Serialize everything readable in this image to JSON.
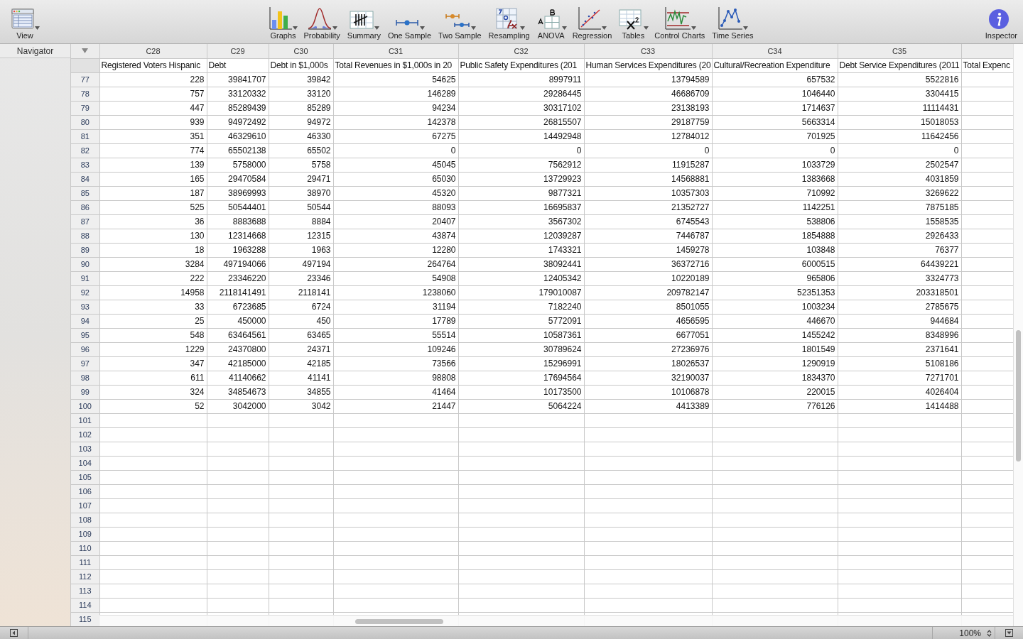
{
  "toolbar": {
    "left": [
      {
        "label": "View"
      }
    ],
    "tools": [
      {
        "label": "Graphs"
      },
      {
        "label": "Probability"
      },
      {
        "label": "Summary"
      },
      {
        "label": "One Sample"
      },
      {
        "label": "Two Sample"
      },
      {
        "label": "Resampling"
      },
      {
        "label": "ANOVA"
      },
      {
        "label": "Regression"
      },
      {
        "label": "Tables"
      },
      {
        "label": "Control Charts"
      },
      {
        "label": "Time Series"
      }
    ],
    "right": [
      {
        "label": "Inspector"
      }
    ]
  },
  "navigator": {
    "title": "Navigator"
  },
  "table": {
    "columns": [
      {
        "id": "C28",
        "name": "Registered Voters Hispanic"
      },
      {
        "id": "C29",
        "name": "Debt"
      },
      {
        "id": "C30",
        "name": "Debt in $1,000s"
      },
      {
        "id": "C31",
        "name": "Total Revenues in $1,000s in 20"
      },
      {
        "id": "C32",
        "name": "Public Safety Expenditures (201"
      },
      {
        "id": "C33",
        "name": "Human Services Expenditures (20"
      },
      {
        "id": "C34",
        "name": "Cultural/Recreation Expenditure"
      },
      {
        "id": "C35",
        "name": "Debt Service Expenditures (2011"
      },
      {
        "name": "Total Expenc"
      }
    ],
    "rows": [
      {
        "number": "77",
        "cells": [
          "228",
          "39841707",
          "39842",
          "54625",
          "8997911",
          "13794589",
          "657532",
          "5522816"
        ]
      },
      {
        "number": "78",
        "cells": [
          "757",
          "33120332",
          "33120",
          "146289",
          "29286445",
          "46686709",
          "1046440",
          "3304415"
        ]
      },
      {
        "number": "79",
        "cells": [
          "447",
          "85289439",
          "85289",
          "94234",
          "30317102",
          "23138193",
          "1714637",
          "11114431"
        ]
      },
      {
        "number": "80",
        "cells": [
          "939",
          "94972492",
          "94972",
          "142378",
          "26815507",
          "29187759",
          "5663314",
          "15018053"
        ]
      },
      {
        "number": "81",
        "cells": [
          "351",
          "46329610",
          "46330",
          "67275",
          "14492948",
          "12784012",
          "701925",
          "11642456"
        ]
      },
      {
        "number": "82",
        "cells": [
          "774",
          "65502138",
          "65502",
          "0",
          "0",
          "0",
          "0",
          "0"
        ]
      },
      {
        "number": "83",
        "cells": [
          "139",
          "5758000",
          "5758",
          "45045",
          "7562912",
          "11915287",
          "1033729",
          "2502547"
        ]
      },
      {
        "number": "84",
        "cells": [
          "165",
          "29470584",
          "29471",
          "65030",
          "13729923",
          "14568881",
          "1383668",
          "4031859"
        ]
      },
      {
        "number": "85",
        "cells": [
          "187",
          "38969993",
          "38970",
          "45320",
          "9877321",
          "10357303",
          "710992",
          "3269622"
        ]
      },
      {
        "number": "86",
        "cells": [
          "525",
          "50544401",
          "50544",
          "88093",
          "16695837",
          "21352727",
          "1142251",
          "7875185"
        ]
      },
      {
        "number": "87",
        "cells": [
          "36",
          "8883688",
          "8884",
          "20407",
          "3567302",
          "6745543",
          "538806",
          "1558535"
        ]
      },
      {
        "number": "88",
        "cells": [
          "130",
          "12314668",
          "12315",
          "43874",
          "12039287",
          "7446787",
          "1854888",
          "2926433"
        ]
      },
      {
        "number": "89",
        "cells": [
          "18",
          "1963288",
          "1963",
          "12280",
          "1743321",
          "1459278",
          "103848",
          "76377"
        ]
      },
      {
        "number": "90",
        "cells": [
          "3284",
          "497194066",
          "497194",
          "264764",
          "38092441",
          "36372716",
          "6000515",
          "64439221"
        ]
      },
      {
        "number": "91",
        "cells": [
          "222",
          "23346220",
          "23346",
          "54908",
          "12405342",
          "10220189",
          "965806",
          "3324773"
        ]
      },
      {
        "number": "92",
        "cells": [
          "14958",
          "2118141491",
          "2118141",
          "1238060",
          "179010087",
          "209782147",
          "52351353",
          "203318501"
        ]
      },
      {
        "number": "93",
        "cells": [
          "33",
          "6723685",
          "6724",
          "31194",
          "7182240",
          "8501055",
          "1003234",
          "2785675"
        ]
      },
      {
        "number": "94",
        "cells": [
          "25",
          "450000",
          "450",
          "17789",
          "5772091",
          "4656595",
          "446670",
          "944684"
        ]
      },
      {
        "number": "95",
        "cells": [
          "548",
          "63464561",
          "63465",
          "55514",
          "10587361",
          "6677051",
          "1455242",
          "8348996"
        ]
      },
      {
        "number": "96",
        "cells": [
          "1229",
          "24370800",
          "24371",
          "109246",
          "30789624",
          "27236976",
          "1801549",
          "2371641"
        ]
      },
      {
        "number": "97",
        "cells": [
          "347",
          "42185000",
          "42185",
          "73566",
          "15296991",
          "18026537",
          "1290919",
          "5108186"
        ]
      },
      {
        "number": "98",
        "cells": [
          "611",
          "41140662",
          "41141",
          "98808",
          "17694564",
          "32190037",
          "1834370",
          "7271701"
        ]
      },
      {
        "number": "99",
        "cells": [
          "324",
          "34854673",
          "34855",
          "41464",
          "10173500",
          "10106878",
          "220015",
          "4026404"
        ]
      },
      {
        "number": "100",
        "cells": [
          "52",
          "3042000",
          "3042",
          "21447",
          "5064224",
          "4413389",
          "776126",
          "1414488"
        ]
      },
      {
        "number": "101"
      },
      {
        "number": "102"
      },
      {
        "number": "103"
      },
      {
        "number": "104"
      },
      {
        "number": "105"
      },
      {
        "number": "106"
      },
      {
        "number": "107"
      },
      {
        "number": "108"
      },
      {
        "number": "109"
      },
      {
        "number": "110"
      },
      {
        "number": "111"
      },
      {
        "number": "112"
      },
      {
        "number": "113"
      },
      {
        "number": "114"
      },
      {
        "number": "115"
      }
    ]
  },
  "status_bar": {
    "zoom": "100%"
  }
}
